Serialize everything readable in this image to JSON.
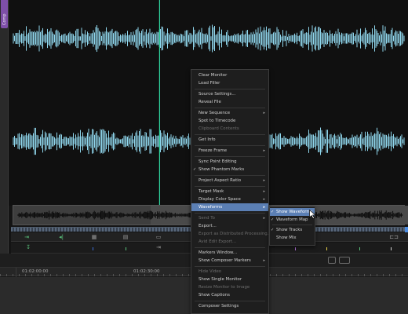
{
  "app": {
    "clip_tab_label": "Comp",
    "clip_tab_color": "#7e4fa8"
  },
  "colors": {
    "waveform": "#8fd6ec",
    "playhead": "#2fd6a0",
    "menu_highlight": "#5b7fb4",
    "progress_cap": "#4b8be0"
  },
  "playhead": {
    "position": 0.378
  },
  "timecodes": [
    "01:02:00:00",
    "01:02:30:00"
  ],
  "context_menu": {
    "items": [
      {
        "label": "Clear Monitor",
        "enabled": true
      },
      {
        "label": "Load Filler",
        "enabled": true
      },
      {
        "sep": true
      },
      {
        "label": "Source Settings...",
        "enabled": true
      },
      {
        "label": "Reveal File",
        "enabled": true
      },
      {
        "sep": true
      },
      {
        "label": "New Sequence",
        "enabled": true,
        "submenu": true
      },
      {
        "label": "Spot to Timecode",
        "enabled": true
      },
      {
        "label": "Clipboard Contents",
        "enabled": false
      },
      {
        "sep": true
      },
      {
        "label": "Get Info",
        "enabled": true
      },
      {
        "sep": true
      },
      {
        "label": "Freeze Frame",
        "enabled": true,
        "submenu": true
      },
      {
        "sep": true
      },
      {
        "label": "Sync Point Editing",
        "enabled": true
      },
      {
        "label": "Show Phantom Marks",
        "enabled": true,
        "checked": true
      },
      {
        "sep": true
      },
      {
        "label": "Project Aspect Ratio",
        "enabled": true,
        "submenu": true
      },
      {
        "sep": true
      },
      {
        "label": "Target Mask",
        "enabled": true,
        "submenu": true
      },
      {
        "label": "Display Color Space",
        "enabled": true,
        "submenu": true
      },
      {
        "label": "Waveforms",
        "enabled": true,
        "submenu": true,
        "highlighted": true
      },
      {
        "sep": true
      },
      {
        "label": "Send To",
        "enabled": false,
        "submenu": true
      },
      {
        "label": "Export...",
        "enabled": true
      },
      {
        "label": "Export as Distributed Processing...",
        "enabled": false
      },
      {
        "label": "Avid Edit Export...",
        "enabled": false
      },
      {
        "sep": true
      },
      {
        "label": "Markers Window...",
        "enabled": true
      },
      {
        "label": "Show Composer Markers",
        "enabled": true,
        "submenu": true
      },
      {
        "sep": true
      },
      {
        "label": "Hide Video",
        "enabled": false
      },
      {
        "label": "Show Single Monitor",
        "enabled": true
      },
      {
        "label": "Resize Monitor to Image",
        "enabled": false
      },
      {
        "label": "Show Captions",
        "enabled": true
      },
      {
        "sep": true
      },
      {
        "label": "Composer Settings",
        "enabled": true
      }
    ]
  },
  "waveforms_submenu": {
    "items": [
      {
        "label": "Show Waveforms",
        "checked": true,
        "highlighted": true
      },
      {
        "label": "Waveform Map",
        "checked": true
      },
      {
        "sep": true
      },
      {
        "label": "Show Tracks",
        "checked": true
      },
      {
        "label": "Show Mix",
        "checked": false
      }
    ]
  }
}
